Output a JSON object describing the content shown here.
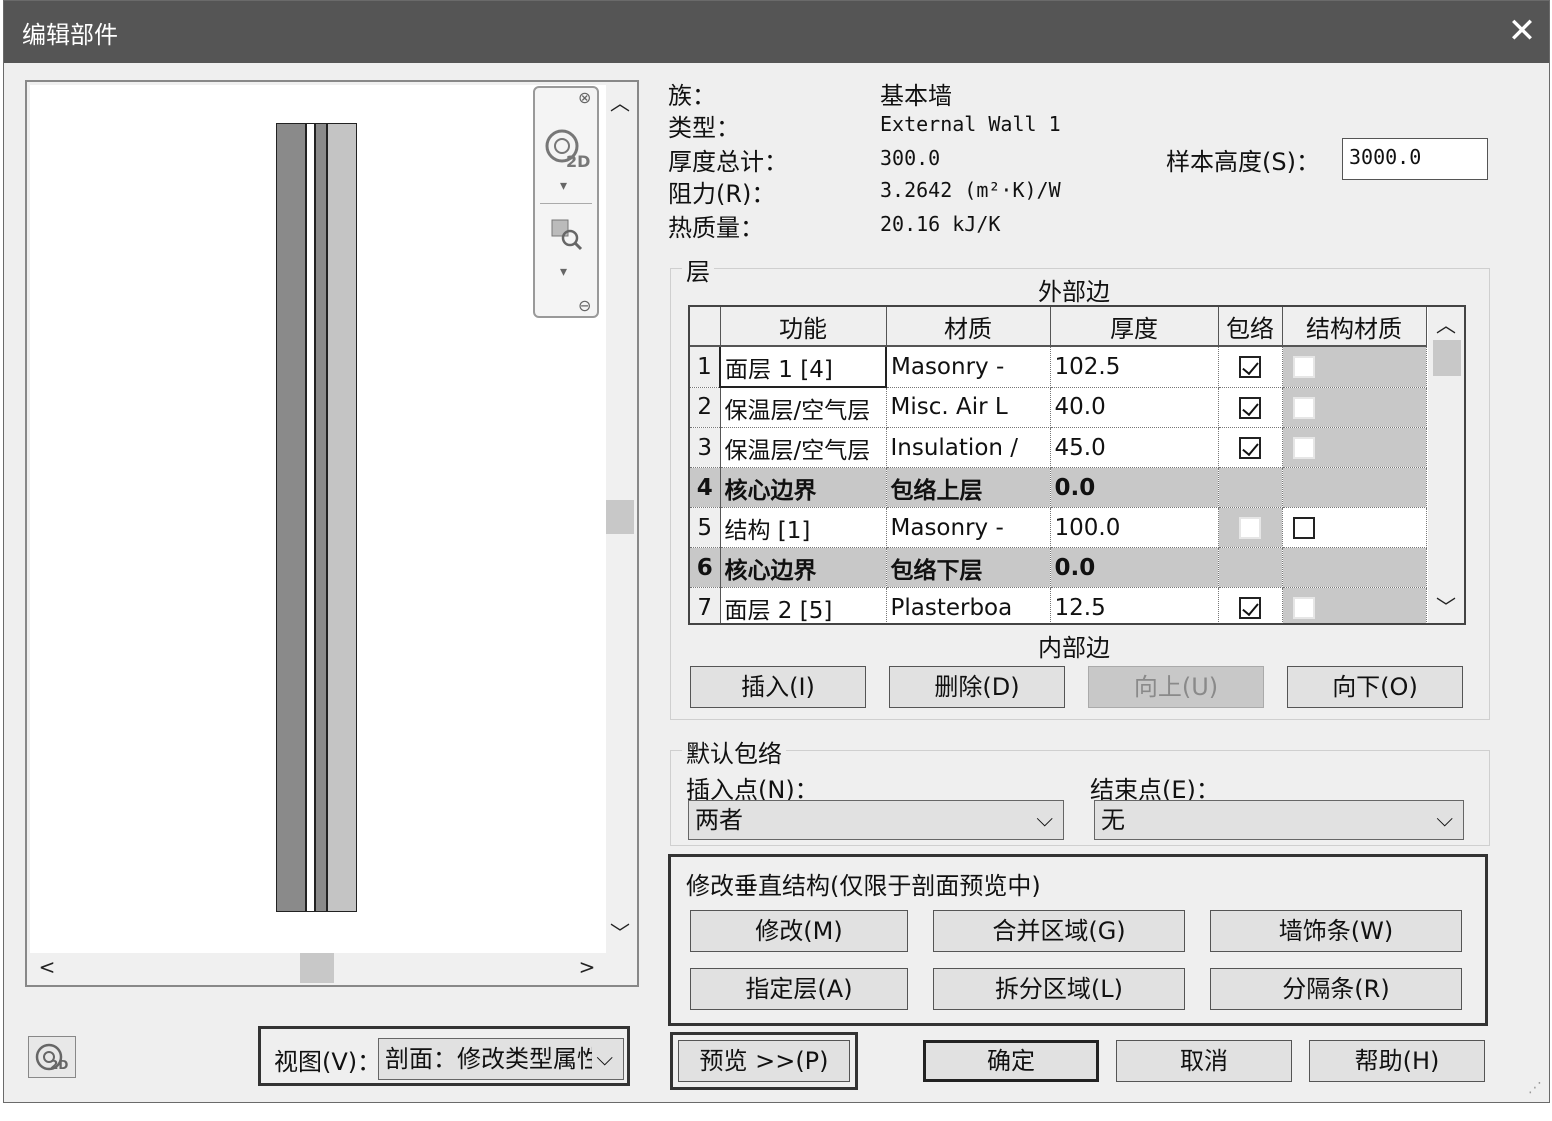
{
  "window": {
    "title": "编辑部件",
    "close_glyph": "✕"
  },
  "preview": {
    "nav": {
      "icon_2d_label": "2D"
    },
    "scroll": {
      "up": "︿",
      "down": "﹀",
      "left": "<",
      "right": ">"
    },
    "view_label": "视图(V)：",
    "view_value": "剖面：修改类型属性"
  },
  "info": {
    "family_label": "族：",
    "family_value": "基本墙",
    "type_label": "类型：",
    "type_value": "External Wall 1",
    "thickness_label": "厚度总计：",
    "thickness_value": "300.0",
    "resistance_label": "阻力(R)：",
    "resistance_value": "3.2642 (m²·K)/W",
    "thermal_label": "热质量：",
    "thermal_value": "20.16 kJ/K",
    "sample_height_label": "样本高度(S)：",
    "sample_height_value": "3000.0"
  },
  "layers": {
    "group_title": "层",
    "exterior_label": "外部边",
    "interior_label": "内部边",
    "columns": [
      "功能",
      "材质",
      "厚度",
      "包络",
      "结构材质"
    ],
    "rows": [
      {
        "num": "1",
        "function": "面层 1 [4]",
        "material": "Masonry -",
        "thickness": "102.5",
        "wrap": true,
        "structural": false,
        "core": false
      },
      {
        "num": "2",
        "function": "保温层/空气层",
        "material": "Misc. Air L",
        "thickness": "40.0",
        "wrap": true,
        "structural": false,
        "core": false
      },
      {
        "num": "3",
        "function": "保温层/空气层",
        "material": "Insulation /",
        "thickness": "45.0",
        "wrap": true,
        "structural": false,
        "core": false
      },
      {
        "num": "4",
        "function": "核心边界",
        "material": "包络上层",
        "thickness": "0.0",
        "core": true
      },
      {
        "num": "5",
        "function": "结构 [1]",
        "material": "Masonry -",
        "thickness": "100.0",
        "wrap": false,
        "structural": false,
        "core": false
      },
      {
        "num": "6",
        "function": "核心边界",
        "material": "包络下层",
        "thickness": "0.0",
        "core": true
      },
      {
        "num": "7",
        "function": "面层 2 [5]",
        "material": "Plasterboa",
        "thickness": "12.5",
        "wrap": true,
        "structural": false,
        "core": false
      }
    ],
    "buttons": {
      "insert": "插入(I)",
      "delete": "删除(D)",
      "up": "向上(U)",
      "down": "向下(O)"
    },
    "scroll": {
      "up": "︿",
      "down": "﹀"
    }
  },
  "default_wrap": {
    "group_title": "默认包络",
    "insert_label": "插入点(N)：",
    "insert_value": "两者",
    "end_label": "结束点(E)：",
    "end_value": "无"
  },
  "vertical": {
    "group_title": "修改垂直结构(仅限于剖面预览中)",
    "buttons": {
      "modify": "修改(M)",
      "merge": "合并区域(G)",
      "sweep": "墙饰条(W)",
      "assign": "指定层(A)",
      "split": "拆分区域(L)",
      "reveal": "分隔条(R)"
    }
  },
  "footer": {
    "preview": "预览 >>(P)",
    "ok": "确定",
    "cancel": "取消",
    "help": "帮助(H)"
  }
}
